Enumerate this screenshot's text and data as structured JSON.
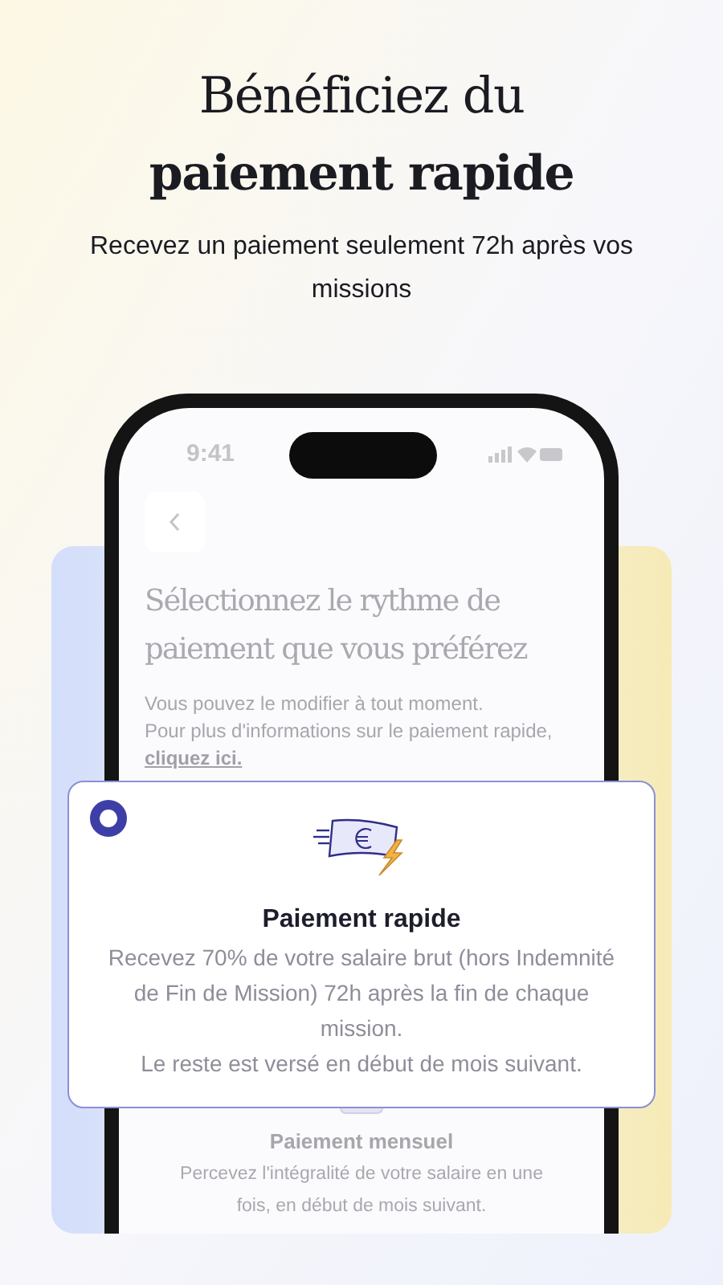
{
  "headline": {
    "line_1": "Bénéficiez du",
    "line_2": "paiement rapide"
  },
  "subtitle": "Recevez un paiement seulement 72h après vos missions",
  "phone": {
    "status_time": "9:41",
    "title": "Sélectionnez le rythme de paiement que vous préférez",
    "note_lines": [
      "Vous pouvez le modifier à tout moment.",
      "Pour plus d'informations sur le paiement rapide,"
    ],
    "link": "cliquez ici.",
    "options": [
      {
        "title": "Paiement mensuel",
        "description": "Percevez l'intégralité de votre salaire en une fois, en début de mois suivant."
      }
    ]
  },
  "highlighted_option": {
    "title": "Paiement rapide",
    "description_lines": [
      "Recevez 70% de votre salaire brut (hors Indemnité de Fin de Mission) 72h après la fin de chaque mission.",
      "Le reste est versé en début de mois suivant."
    ],
    "selected": true
  }
}
